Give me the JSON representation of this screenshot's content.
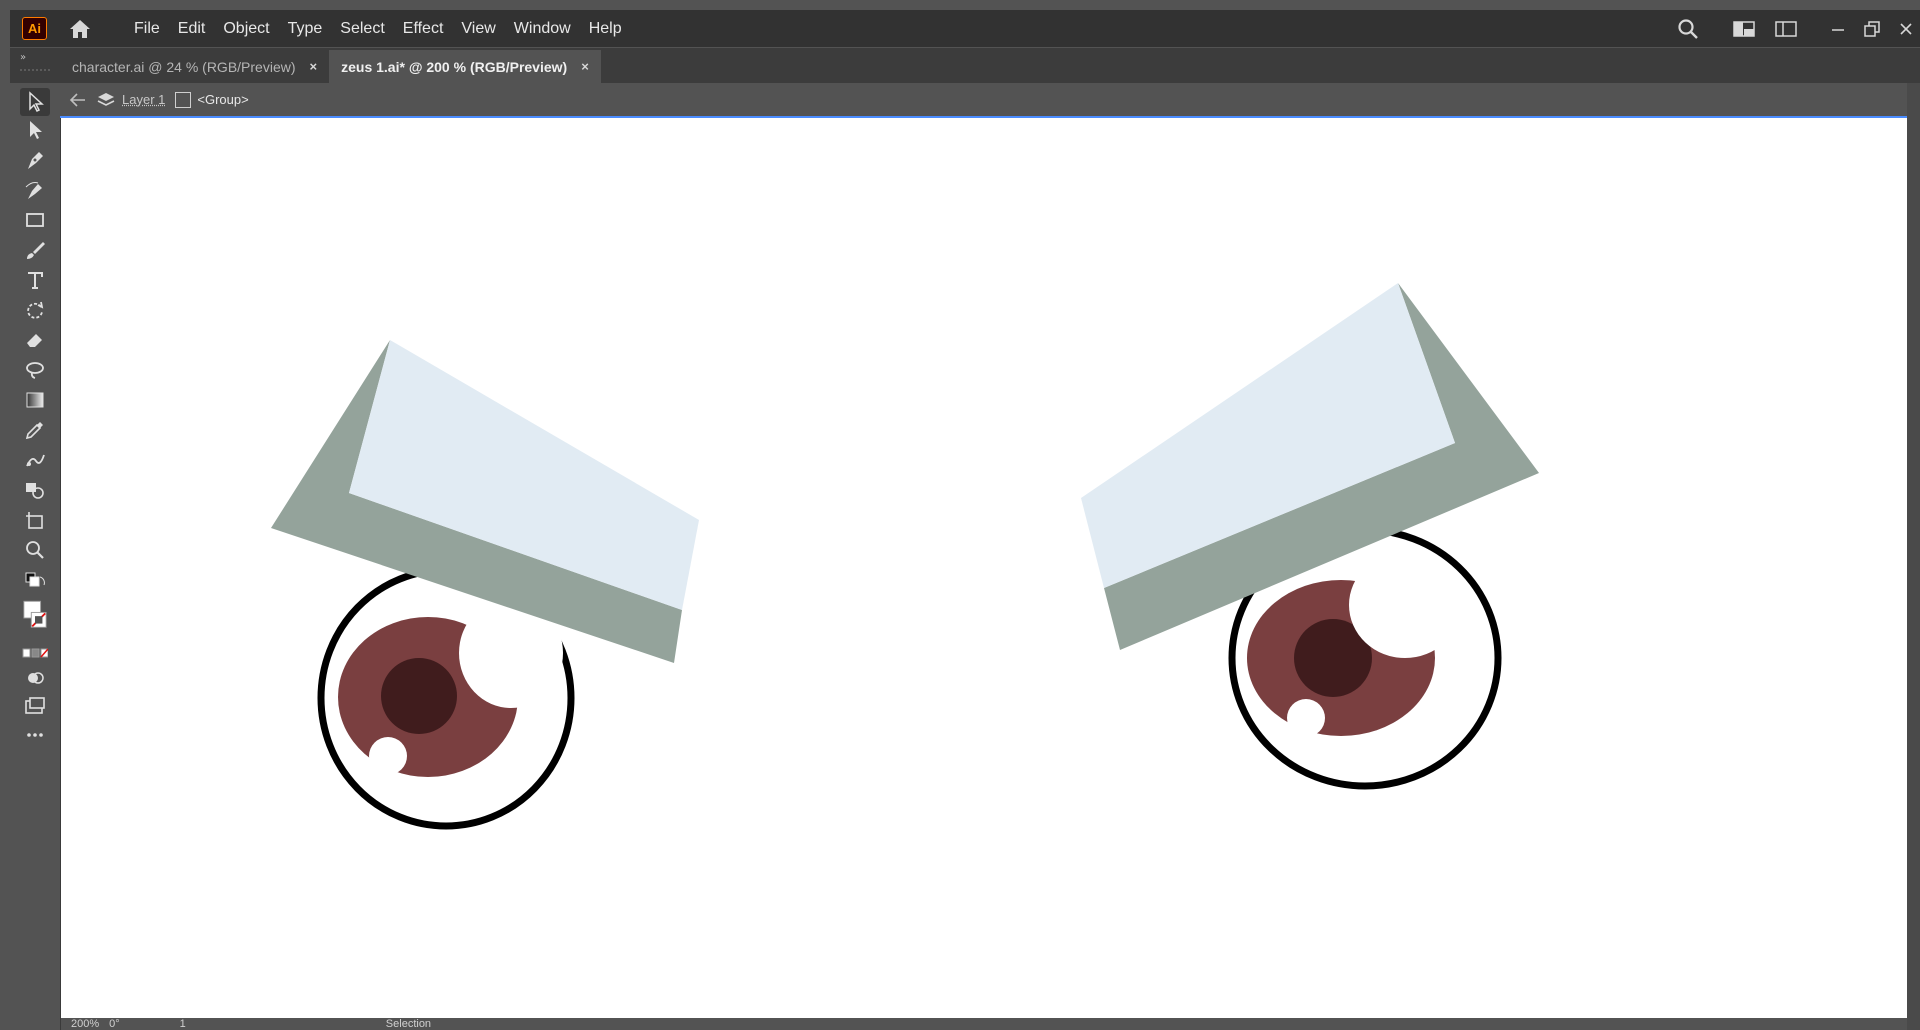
{
  "app": {
    "logo_text": "Ai"
  },
  "menu": [
    "File",
    "Edit",
    "Object",
    "Type",
    "Select",
    "Effect",
    "View",
    "Window",
    "Help"
  ],
  "tabs": [
    {
      "label": "character.ai @ 24 % (RGB/Preview)",
      "close": "×",
      "active": false
    },
    {
      "label": "zeus 1.ai* @ 200 % (RGB/Preview)",
      "close": "×",
      "active": true
    }
  ],
  "breadcrumb": {
    "layer": "Layer 1",
    "group": "<Group>"
  },
  "status": {
    "zoom": "200%",
    "rotation": "0°",
    "artboard": "1",
    "mode": "Selection"
  },
  "colors": {
    "brow_front": "#e1ebf3",
    "brow_back": "#94a39b",
    "iris": "#7a3f40",
    "pupil": "#401c1d",
    "outline": "#000000"
  },
  "icons": [
    "selection-tool-icon",
    "direct-selection-tool-icon",
    "pen-tool-icon",
    "curvature-tool-icon",
    "rectangle-tool-icon",
    "paintbrush-tool-icon",
    "type-tool-icon",
    "rotate-tool-icon",
    "eraser-tool-icon",
    "lasso-tool-icon",
    "gradient-tool-icon",
    "eyedropper-tool-icon",
    "puppet-warp-tool-icon",
    "shape-builder-tool-icon",
    "artboard-tool-icon",
    "zoom-tool-icon"
  ]
}
